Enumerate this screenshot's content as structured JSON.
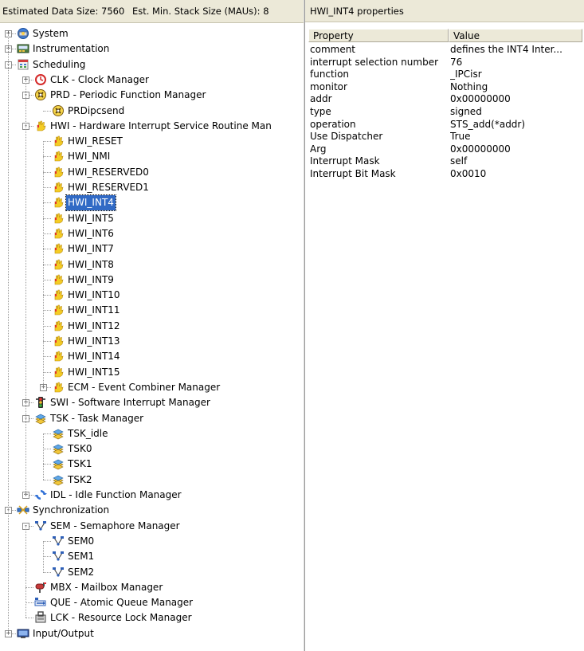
{
  "status": {
    "estimated_data_size": "Estimated Data Size: 7560",
    "min_stack_size": "Est. Min. Stack Size (MAUs): 8"
  },
  "properties_panel": {
    "title": "HWI_INT4 properties",
    "columns": [
      "Property",
      "Value"
    ],
    "rows": [
      {
        "key": "comment",
        "value": "defines the INT4 Inter..."
      },
      {
        "key": "interrupt selection number",
        "value": "76"
      },
      {
        "key": "function",
        "value": "_IPCisr"
      },
      {
        "key": "monitor",
        "value": "Nothing"
      },
      {
        "key": "addr",
        "value": "0x00000000"
      },
      {
        "key": "type",
        "value": "signed"
      },
      {
        "key": "operation",
        "value": "STS_add(*addr)"
      },
      {
        "key": "Use Dispatcher",
        "value": "True"
      },
      {
        "key": "Arg",
        "value": "0x00000000"
      },
      {
        "key": "Interrupt Mask",
        "value": "self"
      },
      {
        "key": "Interrupt Bit Mask",
        "value": "0x0010"
      }
    ]
  },
  "tree": [
    {
      "label": "System",
      "level": 0,
      "expander": "+",
      "icon": "system-icon"
    },
    {
      "label": "Instrumentation",
      "level": 0,
      "expander": "+",
      "icon": "instrumentation-icon"
    },
    {
      "label": "Scheduling",
      "level": 0,
      "expander": "-",
      "icon": "scheduling-icon"
    },
    {
      "label": "CLK - Clock Manager",
      "level": 1,
      "expander": "+",
      "icon": "clock-icon"
    },
    {
      "label": "PRD - Periodic Function Manager",
      "level": 1,
      "expander": "-",
      "icon": "periodic-function-icon"
    },
    {
      "label": "PRDipcsend",
      "level": 2,
      "expander": "",
      "icon": "periodic-function-icon"
    },
    {
      "label": "HWI - Hardware Interrupt Service Routine Man",
      "level": 1,
      "expander": "-",
      "icon": "hardware-interrupt-icon"
    },
    {
      "label": "HWI_RESET",
      "level": 2,
      "expander": "",
      "icon": "hardware-interrupt-icon"
    },
    {
      "label": "HWI_NMI",
      "level": 2,
      "expander": "",
      "icon": "hardware-interrupt-icon"
    },
    {
      "label": "HWI_RESERVED0",
      "level": 2,
      "expander": "",
      "icon": "hardware-interrupt-icon"
    },
    {
      "label": "HWI_RESERVED1",
      "level": 2,
      "expander": "",
      "icon": "hardware-interrupt-icon"
    },
    {
      "label": "HWI_INT4",
      "level": 2,
      "expander": "",
      "icon": "hardware-interrupt-icon",
      "selected": true
    },
    {
      "label": "HWI_INT5",
      "level": 2,
      "expander": "",
      "icon": "hardware-interrupt-icon"
    },
    {
      "label": "HWI_INT6",
      "level": 2,
      "expander": "",
      "icon": "hardware-interrupt-icon"
    },
    {
      "label": "HWI_INT7",
      "level": 2,
      "expander": "",
      "icon": "hardware-interrupt-icon"
    },
    {
      "label": "HWI_INT8",
      "level": 2,
      "expander": "",
      "icon": "hardware-interrupt-icon"
    },
    {
      "label": "HWI_INT9",
      "level": 2,
      "expander": "",
      "icon": "hardware-interrupt-icon"
    },
    {
      "label": "HWI_INT10",
      "level": 2,
      "expander": "",
      "icon": "hardware-interrupt-icon"
    },
    {
      "label": "HWI_INT11",
      "level": 2,
      "expander": "",
      "icon": "hardware-interrupt-icon"
    },
    {
      "label": "HWI_INT12",
      "level": 2,
      "expander": "",
      "icon": "hardware-interrupt-icon"
    },
    {
      "label": "HWI_INT13",
      "level": 2,
      "expander": "",
      "icon": "hardware-interrupt-icon"
    },
    {
      "label": "HWI_INT14",
      "level": 2,
      "expander": "",
      "icon": "hardware-interrupt-icon"
    },
    {
      "label": "HWI_INT15",
      "level": 2,
      "expander": "",
      "icon": "hardware-interrupt-icon"
    },
    {
      "label": "ECM - Event Combiner Manager",
      "level": 2,
      "expander": "+",
      "icon": "hardware-interrupt-icon"
    },
    {
      "label": "SWI - Software Interrupt Manager",
      "level": 1,
      "expander": "+",
      "icon": "software-interrupt-icon"
    },
    {
      "label": "TSK - Task Manager",
      "level": 1,
      "expander": "-",
      "icon": "task-icon"
    },
    {
      "label": "TSK_idle",
      "level": 2,
      "expander": "",
      "icon": "task-icon"
    },
    {
      "label": "TSK0",
      "level": 2,
      "expander": "",
      "icon": "task-icon"
    },
    {
      "label": "TSK1",
      "level": 2,
      "expander": "",
      "icon": "task-icon"
    },
    {
      "label": "TSK2",
      "level": 2,
      "expander": "",
      "icon": "task-icon"
    },
    {
      "label": "IDL - Idle Function Manager",
      "level": 1,
      "expander": "+",
      "icon": "idle-function-icon"
    },
    {
      "label": "Synchronization",
      "level": 0,
      "expander": "-",
      "icon": "synchronization-icon"
    },
    {
      "label": "SEM - Semaphore Manager",
      "level": 1,
      "expander": "-",
      "icon": "semaphore-icon"
    },
    {
      "label": "SEM0",
      "level": 2,
      "expander": "",
      "icon": "semaphore-icon"
    },
    {
      "label": "SEM1",
      "level": 2,
      "expander": "",
      "icon": "semaphore-icon"
    },
    {
      "label": "SEM2",
      "level": 2,
      "expander": "",
      "icon": "semaphore-icon"
    },
    {
      "label": "MBX - Mailbox Manager",
      "level": 1,
      "expander": "",
      "icon": "mailbox-icon"
    },
    {
      "label": "QUE - Atomic Queue Manager",
      "level": 1,
      "expander": "",
      "icon": "queue-icon"
    },
    {
      "label": "LCK - Resource Lock Manager",
      "level": 1,
      "expander": "",
      "icon": "lock-icon"
    },
    {
      "label": "Input/Output",
      "level": 0,
      "expander": "+",
      "icon": "input-output-icon"
    }
  ]
}
